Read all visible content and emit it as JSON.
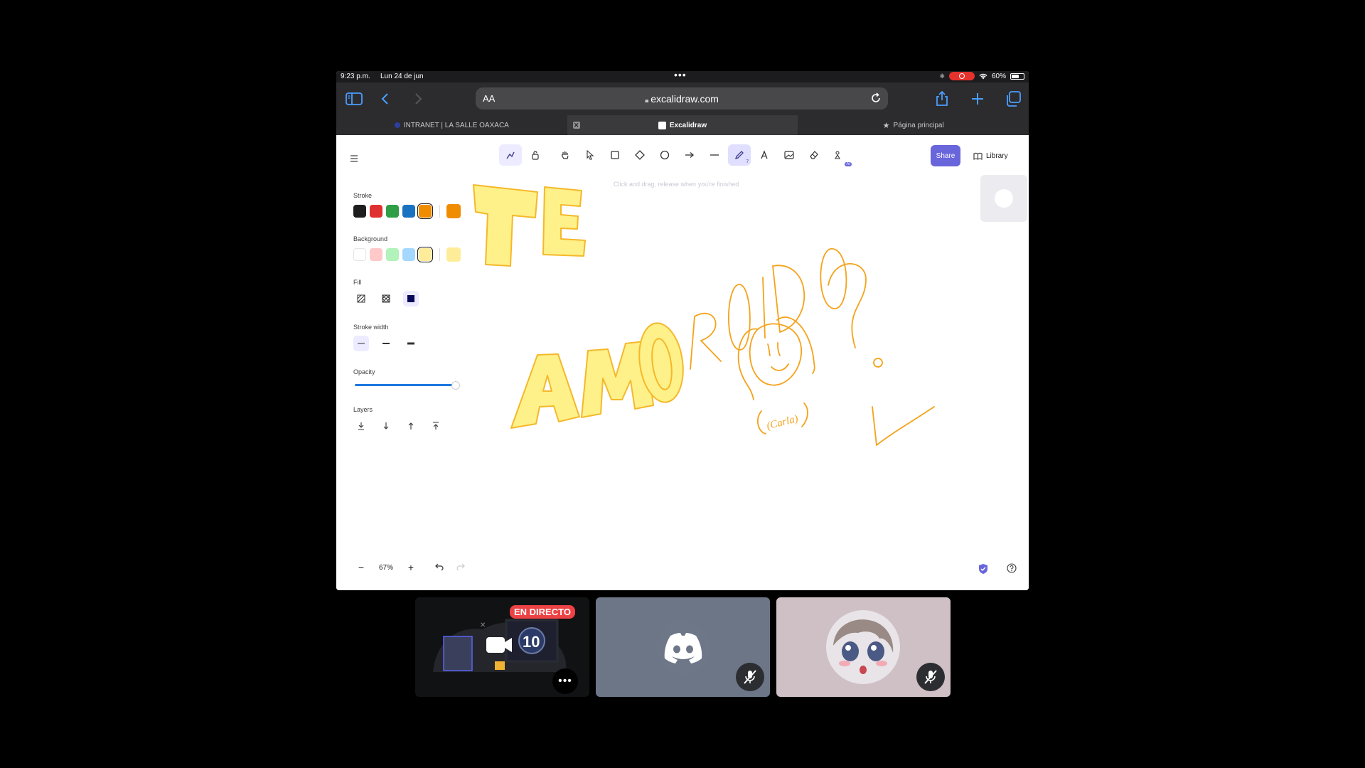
{
  "status": {
    "time": "9:23 p.m.",
    "date": "Lun 24 de jun",
    "battery": "60%"
  },
  "browser": {
    "aa": "AA",
    "url": "excalidraw.com",
    "tabs": [
      {
        "label": "INTRANET | LA SALLE OAXACA"
      },
      {
        "label": "Excalidraw"
      },
      {
        "label": "Página principal"
      }
    ]
  },
  "excalidraw": {
    "share": "Share",
    "library": "Library",
    "hint": "Click and drag, release when you're finished",
    "pen_badge": "7",
    "ai_badge": "AI",
    "props": {
      "stroke": "Stroke",
      "background": "Background",
      "fill": "Fill",
      "stroke_width": "Stroke width",
      "opacity": "Opacity",
      "opacity_value": 1.0,
      "layers": "Layers"
    },
    "stroke_colors": [
      "#1e1e1e",
      "#e03131",
      "#2f9e44",
      "#1971c2",
      "#f08c00"
    ],
    "stroke_current": "#f08c00",
    "background_colors": [
      "#ffffff",
      "#ffc9c9",
      "#b2f2bb",
      "#a5d8ff",
      "#ffec99"
    ],
    "background_current": "#ffec99",
    "zoom": "67%",
    "drawing_text": {
      "te": "TE",
      "amo": "AMO",
      "roido": "ROIDO",
      "carla": "(Carla)"
    }
  },
  "discord": {
    "live": "EN DIRECTO",
    "countdown": "10"
  }
}
